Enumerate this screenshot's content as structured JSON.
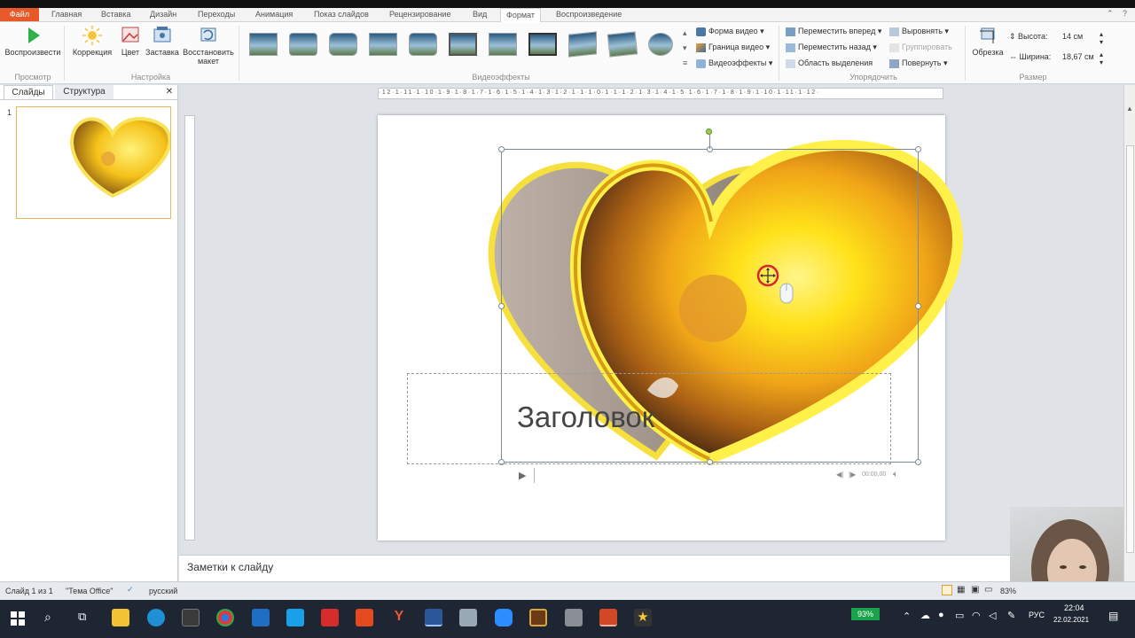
{
  "ribbon_tabs": {
    "file": "Файл",
    "home": "Главная",
    "insert": "Вставка",
    "design": "Дизайн",
    "transitions": "Переходы",
    "animation": "Анимация",
    "slideshow": "Показ слайдов",
    "review": "Рецензирование",
    "view": "Вид",
    "format": "Формат",
    "playback": "Воспроизведение"
  },
  "ribbon": {
    "play_label": "Воспроизвести",
    "correction_label": "Коррекция",
    "color_label": "Цвет",
    "poster_label": "Заставка",
    "reset_label_1": "Восстановить",
    "reset_label_2": "макет",
    "group_preview": "Просмотр",
    "group_adjust": "Настройка",
    "group_video_effects": "Видеоэффекты",
    "video_shape": "Форма видео",
    "video_border": "Граница видео",
    "video_effects": "Видеоэффекты",
    "bring_forward": "Переместить вперед",
    "send_backward": "Переместить назад",
    "selection_pane": "Область выделения",
    "align": "Выровнять",
    "group": "Группировать",
    "rotate": "Повернуть",
    "group_arrange": "Упорядочить",
    "crop_label": "Обрезка",
    "height_label": "Высота:",
    "height_value": "14 см",
    "width_label": "Ширина:",
    "width_value": "18,67 см",
    "group_size": "Размер"
  },
  "left_pane": {
    "tab_slides": "Слайды",
    "tab_outline": "Структура",
    "slide_number": "1"
  },
  "ruler": {
    "ticks": "·12·1·11·1·10·1·9·1·8·1·7·1·6·1·5·1·4·1·3·1·2·1·1·1·0·1·1·1·2·1·3·1·4·1·5·1·6·1·7·1·8·1·9·1·10·1·11·1·12·"
  },
  "slide": {
    "title": "Заголовок",
    "media_time": "00:00,00"
  },
  "notes": {
    "placeholder": "Заметки к слайду"
  },
  "status": {
    "slide_info": "Слайд 1 из 1",
    "theme": "\"Тема Office\"",
    "language": "русский",
    "zoom": "83%"
  },
  "taskbar": {
    "battery": "93%",
    "lang": "РУС",
    "time": "22:04",
    "date": "22.02.2021"
  },
  "colors": {
    "file_tab": "#e65a2a",
    "heart_yellow": "#ffe21a",
    "heart_orange": "#c8760e",
    "selection": "#7d8b98"
  }
}
